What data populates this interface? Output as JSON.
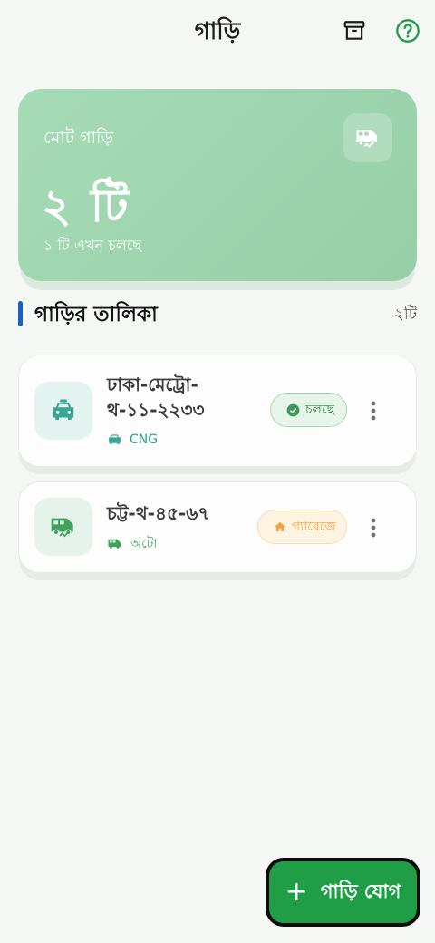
{
  "header": {
    "title": "গাড়ি",
    "archive_icon": "archive-icon",
    "help_icon": "help-circle-icon"
  },
  "summary": {
    "label": "মোট গাড়ি",
    "count": "২ টি",
    "subtitle": "১ টি এখন চলছে",
    "icon": "rv-van-icon"
  },
  "section": {
    "title": "গাড়ির তালিকা",
    "count": "২টি"
  },
  "vehicles": [
    {
      "number": "ঢাকা-মেট্রো-থ-১১-২২৩৩",
      "type": "CNG",
      "type_icon": "taxi-icon",
      "status": "চলছে",
      "status_icon": "check-circle-icon",
      "status_color": "#2f8a46"
    },
    {
      "number": "চট্ট-থ-৪৫-৬৭",
      "type": "অটো",
      "type_icon": "rv-van-icon",
      "status": "গ্যারেজে",
      "status_icon": "home-icon",
      "status_color": "#f2a33b"
    }
  ],
  "fab": {
    "label": "গাড়ি যোগ",
    "icon": "plus-icon"
  },
  "colors": {
    "accent": "#1f9d47",
    "summary_card": "#a6dbb6",
    "section_bar": "#1565c0",
    "background": "#f5f7f5"
  }
}
